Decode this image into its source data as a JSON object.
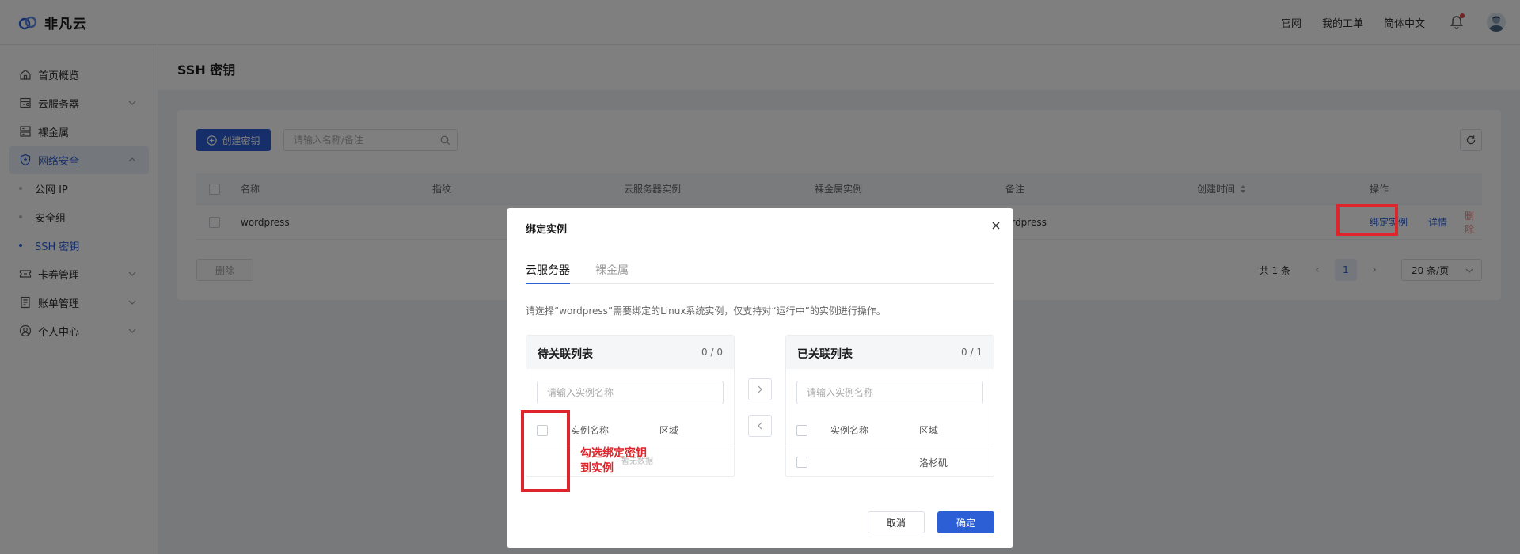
{
  "app": {
    "brand": "非凡云",
    "top_links": [
      "官网",
      "我的工单",
      "简体中文"
    ]
  },
  "sidebar": {
    "items": [
      {
        "label": "首页概览",
        "icon": "home-icon"
      },
      {
        "label": "云服务器",
        "icon": "server-icon"
      },
      {
        "label": "裸金属",
        "icon": "bare-metal-icon"
      },
      {
        "label": "网络安全",
        "icon": "shield-icon"
      },
      {
        "label": "卡券管理",
        "icon": "coupon-icon"
      },
      {
        "label": "账单管理",
        "icon": "bill-icon"
      },
      {
        "label": "个人中心",
        "icon": "user-icon"
      }
    ],
    "sub_items": [
      "公网 IP",
      "安全组",
      "SSH 密钥"
    ]
  },
  "page": {
    "title": "SSH 密钥",
    "create_button": "创建密钥",
    "search_placeholder": "请输入名称/备注",
    "table": {
      "headers": [
        "名称",
        "指纹",
        "云服务器实例",
        "裸金属实例",
        "备注",
        "创建时间",
        "操作"
      ],
      "rows": [
        {
          "name": "wordpress",
          "remark": "ordpress",
          "ops": [
            "绑定实例",
            "详情",
            "删除"
          ]
        }
      ]
    },
    "bulk_delete": "删除",
    "pagination": {
      "total": "共 1 条",
      "current": "1",
      "page_size": "20 条/页"
    }
  },
  "modal": {
    "title": "绑定实例",
    "tabs": [
      "云服务器",
      "裸金属"
    ],
    "note": "请选择“wordpress”需要绑定的Linux系统实例，仅支持对“运行中”的实例进行操作。",
    "left_panel": {
      "title": "待关联列表",
      "count": "0 / 0",
      "search_placeholder": "请输入实例名称",
      "columns": [
        "实例名称",
        "区域"
      ],
      "empty_text": "暂无数据"
    },
    "right_panel": {
      "title": "已关联列表",
      "count": "0 / 1",
      "search_placeholder": "请输入实例名称",
      "columns": [
        "实例名称",
        "区域"
      ],
      "rows": [
        {
          "name": "",
          "region": "洛杉矶"
        }
      ]
    },
    "cancel": "取消",
    "confirm": "确定"
  },
  "annotation": {
    "line1": "勾选绑定密钥",
    "line2": "到实例"
  },
  "colors": {
    "primary": "#2c5fd6",
    "annotation_red": "#e0242b",
    "danger_light": "#e8888a"
  }
}
